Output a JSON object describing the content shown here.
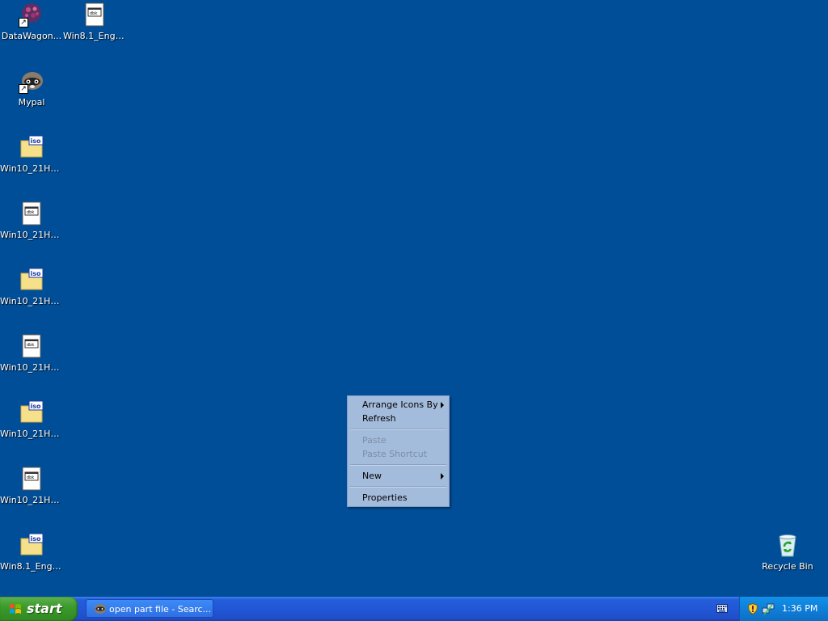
{
  "desktop": {
    "background_color": "#004e98",
    "icons": [
      {
        "label": "DataWagon...",
        "icon": "datawagon-icon"
      },
      {
        "label": "Win8.1_Engl...",
        "icon": "document-icon"
      },
      {
        "label": "Mypal",
        "icon": "mypal-raccoon-icon"
      },
      {
        "label": "Win10_21H2...",
        "icon": "iso-file-icon"
      },
      {
        "label": "Win10_21H2...",
        "icon": "document-icon"
      },
      {
        "label": "Win10_21H2...",
        "icon": "iso-file-icon"
      },
      {
        "label": "Win10_21H2...",
        "icon": "document-icon"
      },
      {
        "label": "Win10_21H2...",
        "icon": "iso-file-icon"
      },
      {
        "label": "Win10_21H2...",
        "icon": "document-icon"
      },
      {
        "label": "Win8.1_Engl...",
        "icon": "iso-file-icon"
      },
      {
        "label": "Recycle Bin",
        "icon": "recycle-bin-icon"
      }
    ]
  },
  "context_menu": {
    "items": [
      {
        "label": "Arrange Icons By",
        "submenu": true,
        "enabled": true
      },
      {
        "label": "Refresh",
        "enabled": true
      },
      {
        "label": "Paste",
        "enabled": false
      },
      {
        "label": "Paste Shortcut",
        "enabled": false
      },
      {
        "label": "New",
        "submenu": true,
        "enabled": true
      },
      {
        "label": "Properties",
        "enabled": true
      }
    ]
  },
  "taskbar": {
    "start_label": "start",
    "tasks": [
      {
        "label": "open part file - Searc...",
        "icon": "mypal-raccoon-icon"
      }
    ],
    "tray": {
      "clock": "1:36 PM",
      "icons": [
        "security-shield-icon",
        "network-icon"
      ]
    },
    "language_bar_icon": "keyboard-icon"
  }
}
